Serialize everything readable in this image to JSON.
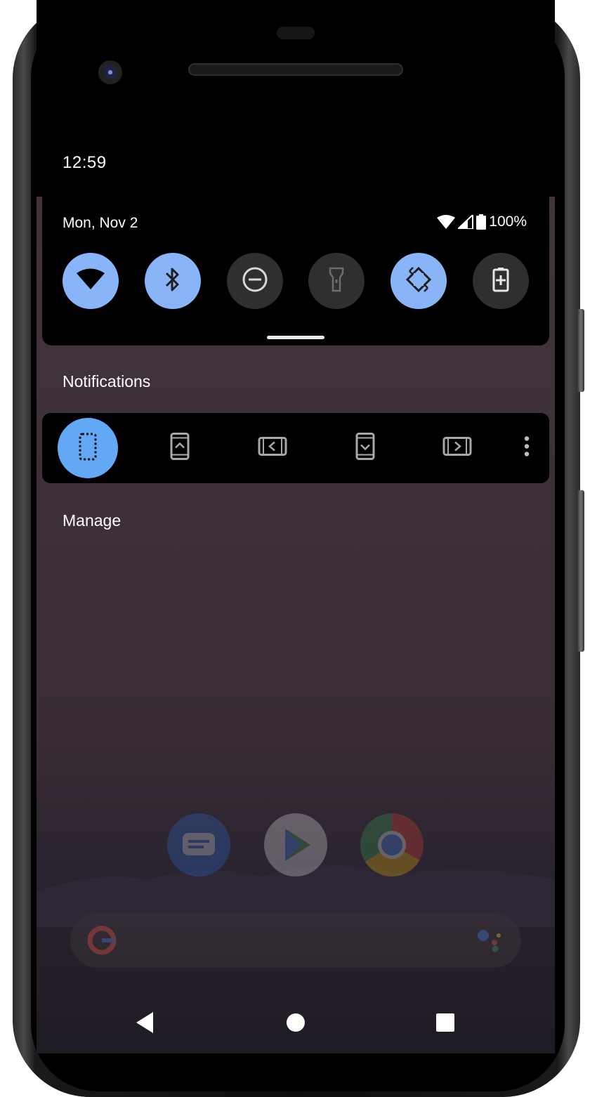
{
  "status": {
    "time": "12:59",
    "date": "Mon, Nov 2",
    "battery_text": "100%"
  },
  "quick_settings": {
    "tiles": [
      {
        "name": "wifi",
        "icon": "wifi-icon",
        "state": "on"
      },
      {
        "name": "bluetooth",
        "icon": "bluetooth-icon",
        "state": "on"
      },
      {
        "name": "do-not-disturb",
        "icon": "do-not-disturb-icon",
        "state": "off"
      },
      {
        "name": "flashlight",
        "icon": "flashlight-icon",
        "state": "off"
      },
      {
        "name": "auto-rotate",
        "icon": "auto-rotate-icon",
        "state": "on"
      },
      {
        "name": "battery-saver",
        "icon": "battery-saver-icon",
        "state": "off"
      }
    ]
  },
  "notifications": {
    "header": "Notifications",
    "rotation_options": [
      {
        "icon": "rotation-free-icon",
        "selected": true
      },
      {
        "icon": "portrait-icon",
        "selected": false
      },
      {
        "icon": "landscape-left-icon",
        "selected": false
      },
      {
        "icon": "portrait-reverse-icon",
        "selected": false
      },
      {
        "icon": "landscape-right-icon",
        "selected": false
      }
    ],
    "more_icon": "more-vert-icon",
    "manage_label": "Manage"
  },
  "home_screen": {
    "dock_apps": [
      "messages-app-icon",
      "play-store-app-icon",
      "chrome-app-icon"
    ],
    "search_icons": [
      "google-g-icon",
      "assistant-icon"
    ]
  },
  "navigation": {
    "buttons": [
      "back-icon",
      "home-icon",
      "recents-icon"
    ]
  },
  "colors": {
    "tile_on": "#8ab4f8",
    "tile_off": "#2f2f2f",
    "rotation_active": "#62a8f5"
  }
}
